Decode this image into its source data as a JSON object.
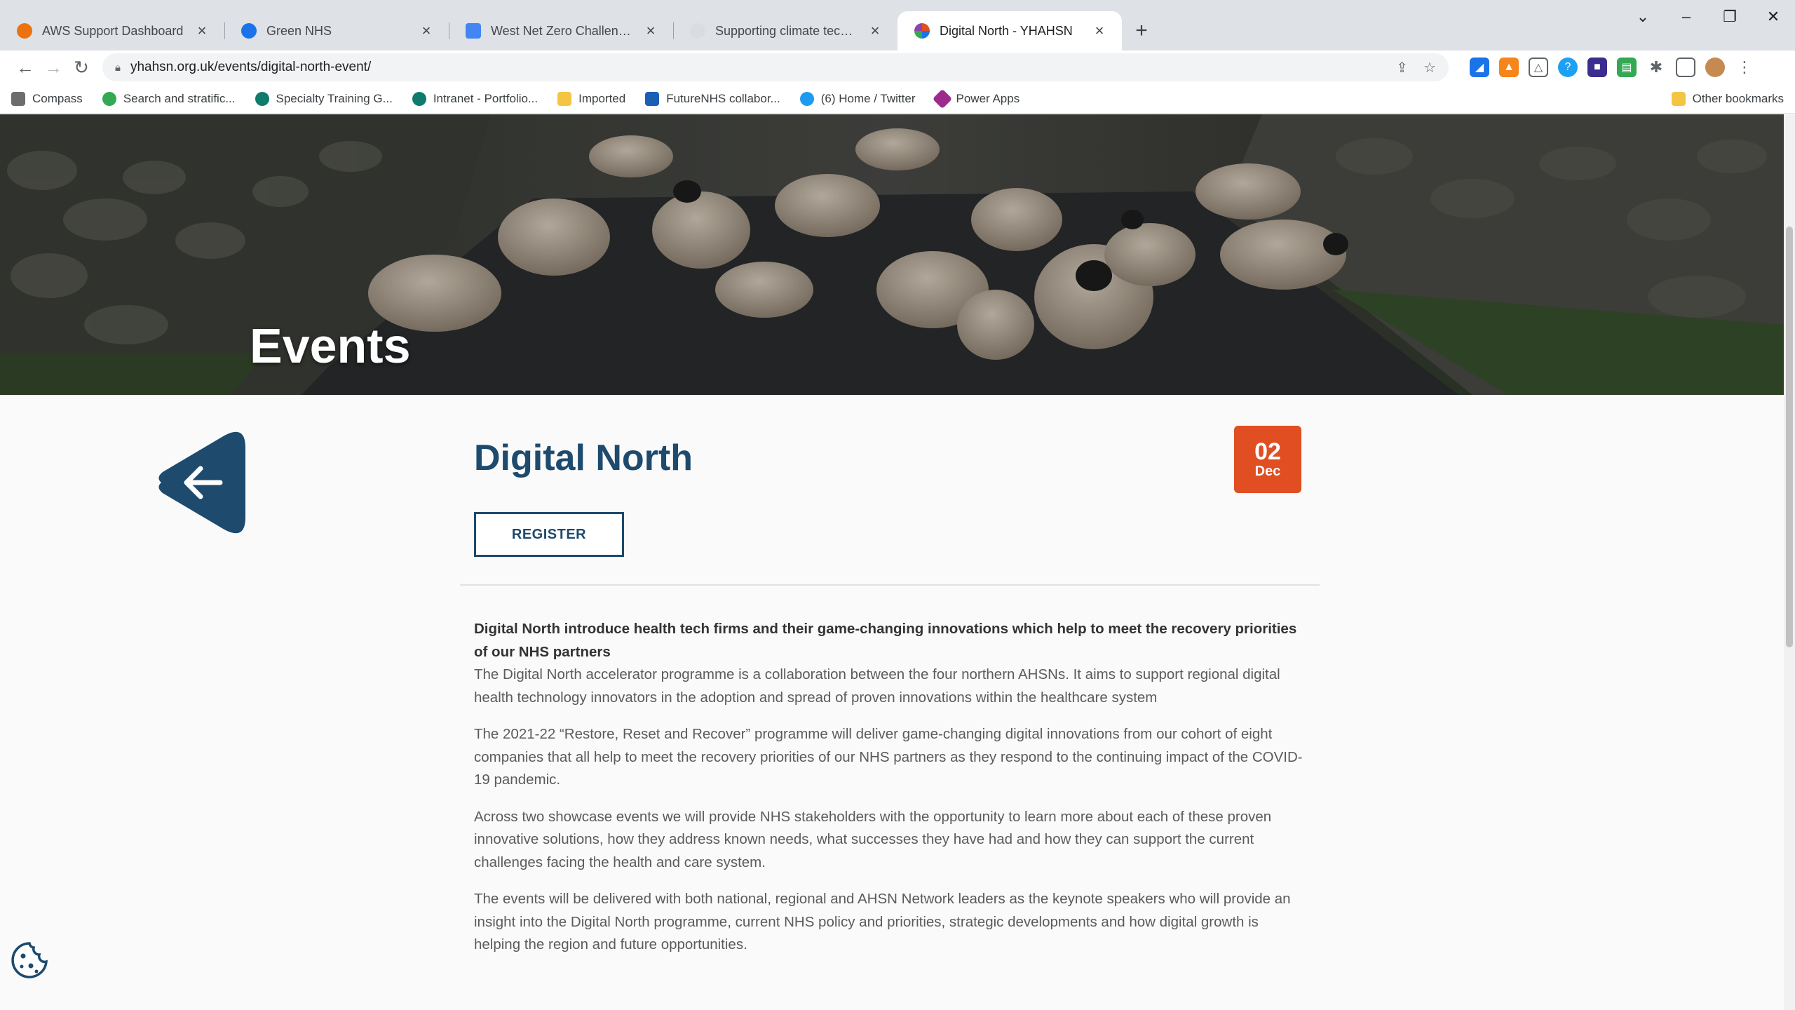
{
  "browser": {
    "tabs": [
      {
        "title": "AWS Support Dashboard",
        "favicon_color": "#ec7211"
      },
      {
        "title": "Green NHS",
        "favicon_color": "#1a73e8"
      },
      {
        "title": "West Net Zero Challenge - West",
        "favicon_color": "#4285f4"
      },
      {
        "title": "Supporting climate tech in healt",
        "favicon_color": "#dadce0"
      },
      {
        "title": "Digital North - YHAHSN",
        "favicon_color": "#8e44ad"
      }
    ],
    "url": "yhahsn.org.uk/events/digital-north-event/",
    "bookmarks": [
      {
        "label": "Compass",
        "color": "#6d6d6d"
      },
      {
        "label": "Search and stratific...",
        "color": "#34a853"
      },
      {
        "label": "Specialty Training G...",
        "color": "#0f7b6c"
      },
      {
        "label": "Intranet - Portfolio...",
        "color": "#0f7b6c"
      },
      {
        "label": "Imported",
        "color": "#f4c542"
      },
      {
        "label": "FutureNHS collabor...",
        "color": "#1a5fb4"
      },
      {
        "label": "(6) Home / Twitter",
        "color": "#1d9bf0"
      },
      {
        "label": "Power Apps",
        "color": "#9b2c8e"
      }
    ],
    "other_bookmarks": "Other bookmarks"
  },
  "hero": {
    "title": "Events"
  },
  "event": {
    "title": "Digital North",
    "date_day": "02",
    "date_month": "Dec",
    "register_label": "REGISTER",
    "lead": "Digital North introduce health tech firms and their game-changing innovations which help to meet the recovery priorities of our NHS partners",
    "paragraphs": [
      "The Digital North accelerator programme is a collaboration between the four northern AHSNs. It aims to support regional digital health technology innovators in the adoption and spread of proven innovations within the healthcare system",
      "The 2021-22 “Restore, Reset and Recover” programme will deliver game-changing digital innovations from our cohort of eight companies that all help to meet the recovery priorities of our NHS partners as they respond to the continuing impact of the COVID-19 pandemic.",
      "Across two showcase events we will provide NHS stakeholders with the opportunity to learn more about each of these proven innovative solutions, how they address known needs, what successes they have had and how they can support the current challenges facing the health and care system.",
      "The events will be delivered with both national, regional and AHSN Network leaders as the keynote speakers who will provide an insight into the Digital North programme, current NHS policy and priorities, strategic developments and how digital growth is helping the region and future opportunities."
    ]
  },
  "colors": {
    "brand_navy": "#1d4a6d",
    "date_badge": "#e04e22"
  }
}
